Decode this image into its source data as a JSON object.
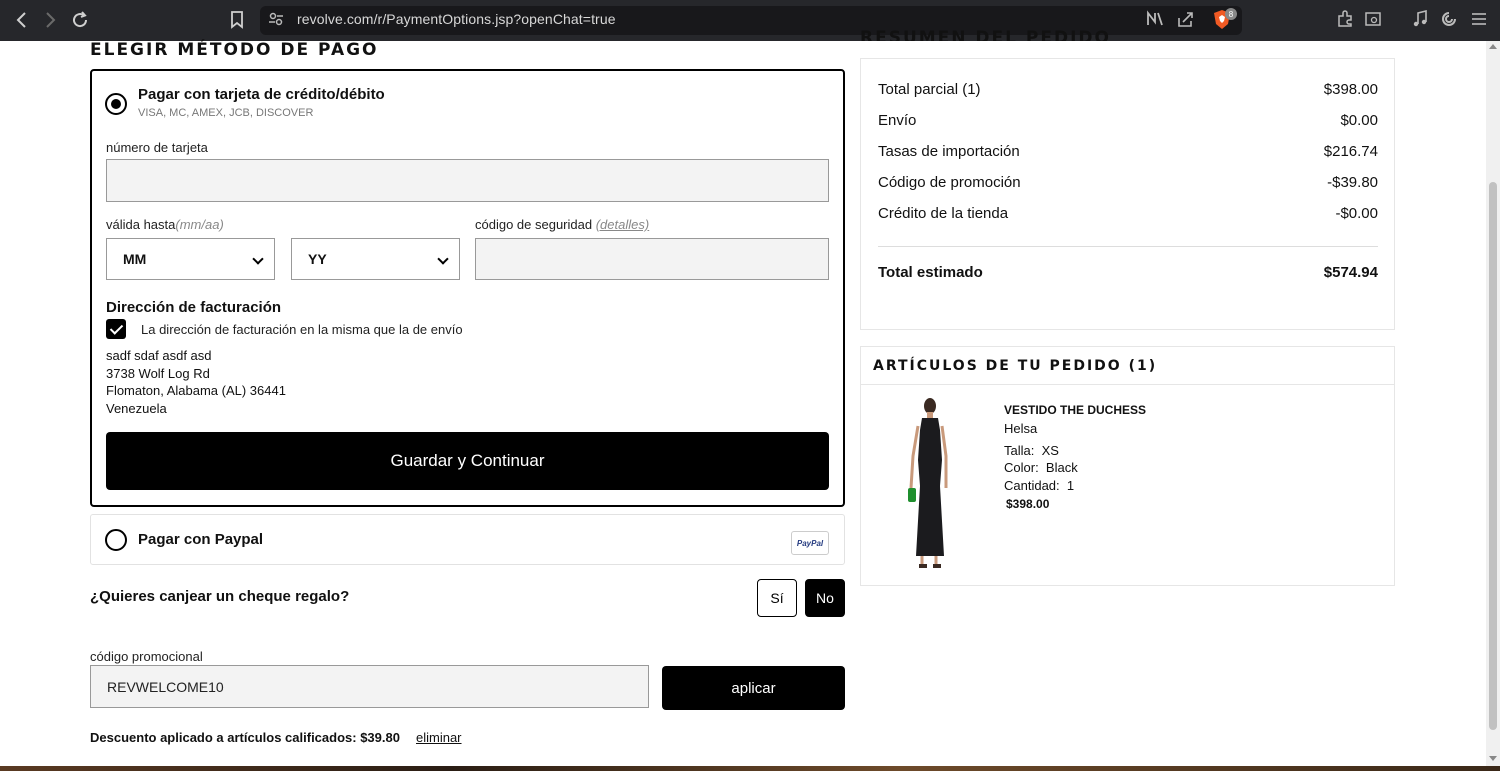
{
  "browser": {
    "url": "revolve.com/r/PaymentOptions.jsp?openChat=true",
    "shield_count": "8"
  },
  "payment": {
    "title": "ELEGIR MÉTODO DE PAGO",
    "card_option": {
      "label": "Pagar con tarjeta de crédito/débito",
      "brands": "VISA, MC, AMEX, JCB, DISCOVER",
      "selected": true
    },
    "card_number_label": "número de tarjeta",
    "card_number_value": "",
    "expiry_label": "válida hasta",
    "expiry_hint": "(mm/aa)",
    "month_select": "MM",
    "year_select": "YY",
    "cvv_label": "código de seguridad",
    "cvv_details_link": "(detalles)",
    "cvv_value": "",
    "billing_title": "Dirección de facturación",
    "same_address_label": "La dirección de facturación en la misma que la de envío",
    "same_address_checked": true,
    "address": {
      "line1": "sadf sdaf asdf asd",
      "line2": "3738 Wolf Log Rd",
      "line3": "Flomaton, Alabama (AL) 36441",
      "line4": "Venezuela"
    },
    "save_button": "Guardar y Continuar",
    "paypal_option": {
      "label": "Pagar con Paypal",
      "logo_text": "PayPal",
      "selected": false
    }
  },
  "gift": {
    "question": "¿Quieres canjear un cheque regalo?",
    "yes_label": "Sí",
    "no_label": "No",
    "selected": "No"
  },
  "promo": {
    "label": "código promocional",
    "value": "REVWELCOME10",
    "apply_button": "aplicar",
    "discount_text": "Descuento aplicado a artículos calificados: $39.80",
    "remove_link": "eliminar"
  },
  "summary": {
    "title": "RESUMEN DEL PEDIDO",
    "rows": [
      {
        "label": "Total parcial (1)",
        "value": "$398.00"
      },
      {
        "label": "Envío",
        "value": "$0.00"
      },
      {
        "label": "Tasas de importación",
        "value": "$216.74"
      },
      {
        "label": "Código de promoción",
        "value": "-$39.80"
      },
      {
        "label": "Crédito de la tienda",
        "value": "-$0.00"
      }
    ],
    "total_label": "Total estimado",
    "total_value": "$574.94"
  },
  "items": {
    "title": "ARTÍCULOS DE TU PEDIDO (1)",
    "list": [
      {
        "name": "VESTIDO THE DUCHESS",
        "brand": "Helsa",
        "size_label": "Talla:",
        "size": "XS",
        "color_label": "Color:",
        "color": "Black",
        "qty_label": "Cantidad:",
        "qty": "1",
        "price": "$398.00"
      }
    ]
  }
}
